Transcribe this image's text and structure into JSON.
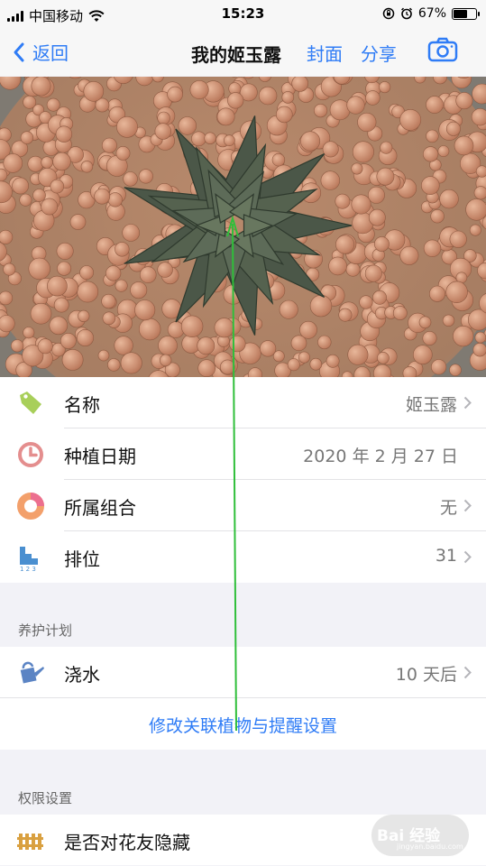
{
  "status_bar": {
    "carrier": "中国移动",
    "time": "15:23",
    "battery_percent": "67%",
    "battery_level": 0.67
  },
  "nav": {
    "back_label": "返回",
    "title": "我的姬玉露",
    "cover_label": "封面",
    "share_label": "分享",
    "camera_icon": "camera-icon"
  },
  "info_rows": [
    {
      "label": "名称",
      "value": "姬玉露",
      "icon": "tag-icon",
      "color": "#a8cf5a",
      "has_chevron": true
    },
    {
      "label": "种植日期",
      "value": "2020 年 2 月 27 日",
      "icon": "clock-icon",
      "color": "#e48e8e",
      "has_chevron": false
    },
    {
      "label": "所属组合",
      "value": "无",
      "icon": "ring-icon",
      "color": "#f08a6a",
      "has_chevron": true
    },
    {
      "label": "排位",
      "value": "31",
      "icon": "rank-icon",
      "color": "#4a8fd0",
      "has_chevron": true
    }
  ],
  "care_plan": {
    "header": "养护计划",
    "watering_label": "浇水",
    "watering_value": "10 天后",
    "link_label": "修改关联植物与提醒设置"
  },
  "permissions": {
    "header": "权限设置",
    "hide_label": "是否对花友隐藏"
  },
  "watermark": {
    "text": "Bai 经验",
    "sub": "jingyan.baidu.com"
  },
  "colors": {
    "accent": "#2f7cf6",
    "arrow": "#2fbf3a",
    "background": "#f2f2f7"
  }
}
